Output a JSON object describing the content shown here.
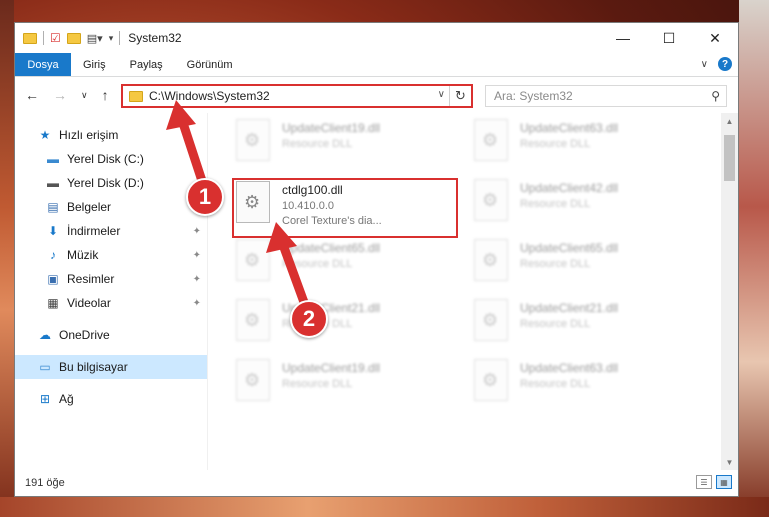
{
  "window": {
    "title": "System32"
  },
  "ribbon": {
    "tabs": [
      "Dosya",
      "Giriş",
      "Paylaş",
      "Görünüm"
    ]
  },
  "address": {
    "path": "C:\\Windows\\System32"
  },
  "search": {
    "placeholder": "Ara: System32"
  },
  "sidebar": {
    "items": [
      {
        "label": "Hızlı erişim",
        "icon": "star-icon"
      },
      {
        "label": "Yerel Disk (C:)",
        "icon": "drive-icon"
      },
      {
        "label": "Yerel Disk (D:)",
        "icon": "drive-icon"
      },
      {
        "label": "Belgeler",
        "icon": "document-icon"
      },
      {
        "label": "İndirmeler",
        "icon": "download-icon"
      },
      {
        "label": "Müzik",
        "icon": "music-icon"
      },
      {
        "label": "Resimler",
        "icon": "pictures-icon"
      },
      {
        "label": "Videolar",
        "icon": "video-icon"
      },
      {
        "label": "OneDrive",
        "icon": "cloud-icon"
      },
      {
        "label": "Bu bilgisayar",
        "icon": "computer-icon"
      },
      {
        "label": "Ağ",
        "icon": "network-icon"
      }
    ]
  },
  "files": {
    "highlighted": {
      "name": "ctdlg100.dll",
      "version": "10.410.0.0",
      "desc": "Corel Texture's dia..."
    },
    "blurred": [
      {
        "name": "UpdateClient19.dll",
        "desc": "Resource DLL"
      },
      {
        "name": "UpdateClient63.dll",
        "desc": "Resource DLL"
      },
      {
        "name": "UpdateClient42.dll",
        "desc": "Resource DLL"
      },
      {
        "name": "UpdateClient65.dll",
        "desc": "Resource DLL"
      },
      {
        "name": "UpdateClient65.dll",
        "desc": "Resource DLL"
      },
      {
        "name": "UpdateClient21.dll",
        "desc": "Resource DLL"
      },
      {
        "name": "UpdateClient21.dll",
        "desc": "Resource DLL"
      },
      {
        "name": "UpdateClient19.dll",
        "desc": "Resource DLL"
      },
      {
        "name": "UpdateClient63.dll",
        "desc": "Resource DLL"
      }
    ]
  },
  "status": {
    "count": "191 öğe"
  },
  "annotations": {
    "badge1": "1",
    "badge2": "2"
  },
  "colors": {
    "accent": "#1979ca",
    "highlight": "#d9302f",
    "selection": "#cce8ff"
  }
}
